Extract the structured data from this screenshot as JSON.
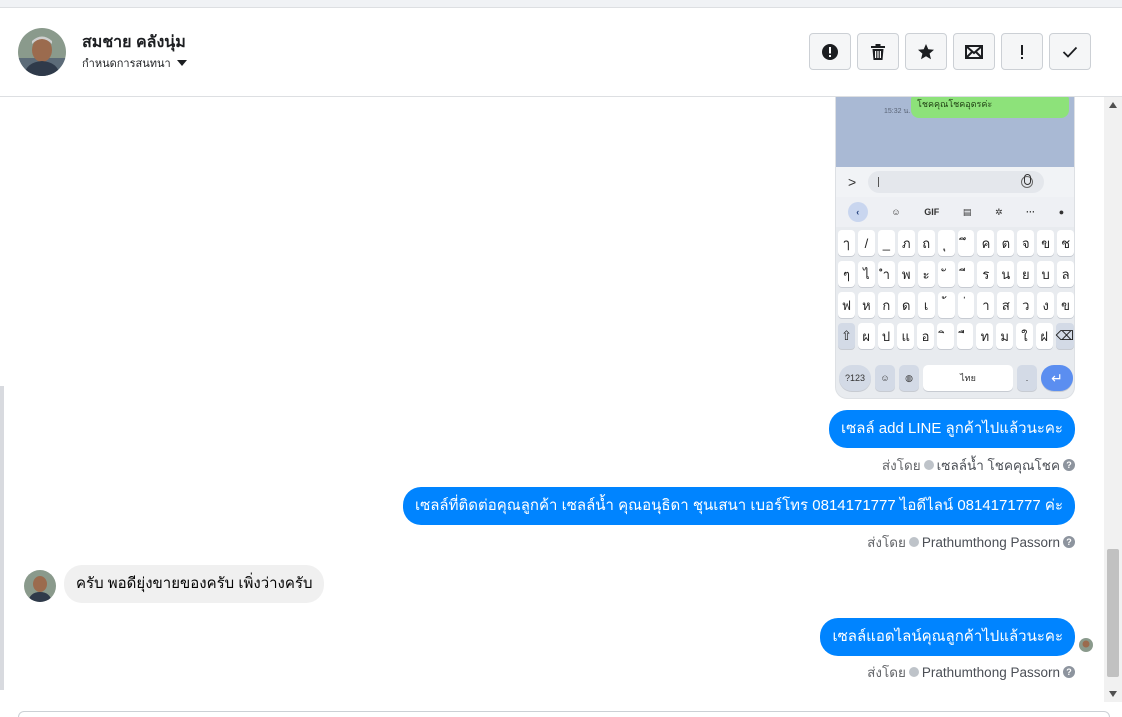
{
  "header": {
    "contact_name": "สมชาย คลังนุ่ม",
    "subtitle": "กำหนดการสนทนา"
  },
  "actions": [
    {
      "icon": "alert-circle-icon"
    },
    {
      "icon": "trash-icon"
    },
    {
      "icon": "star-icon"
    },
    {
      "icon": "mail-icon"
    },
    {
      "icon": "exclamation-icon"
    },
    {
      "icon": "check-icon"
    }
  ],
  "phone_screenshot": {
    "bubble_text": "โชคคุณโชคอุดรค่ะ",
    "time": "15:32 น.",
    "tools": [
      "GIF"
    ],
    "key_rows": [
      [
        "ๅ",
        "/",
        "_",
        "ภ",
        "ถ",
        "ุ",
        "ึ",
        "ค",
        "ต",
        "จ",
        "ข",
        "ช"
      ],
      [
        "ๆ",
        "ไ",
        "ำ",
        "พ",
        "ะ",
        "ั",
        "ี",
        "ร",
        "น",
        "ย",
        "บ",
        "ล"
      ],
      [
        "ฟ",
        "ห",
        "ก",
        "ด",
        "เ",
        "้",
        "่",
        "า",
        "ส",
        "ว",
        "ง",
        "ข"
      ],
      [
        "⇧",
        "ผ",
        "ป",
        "แ",
        "อ",
        "ิ",
        "ื",
        "ท",
        "ม",
        "ใ",
        "ฝ",
        "⌫"
      ]
    ],
    "key_123": "?123",
    "key_space": "ไทย",
    "key_period": "."
  },
  "messages": [
    {
      "text": "เซลล์ add LINE ลูกค้าไปแล้วนะคะ",
      "sent_by_label": "ส่งโดย",
      "sender": "เซลล์น้ำ โชคคุณโชค"
    },
    {
      "text": "เซลล์ที่ติดต่อคุณลูกค้า เซลล์น้ำ คุณอนุธิดา ชุนเสนา เบอร์โทร 0814171777 ไอดีไลน์ 0814171777 ค่ะ",
      "sent_by_label": "ส่งโดย",
      "sender": "Prathumthong Passorn"
    },
    {
      "text": "ครับ พอดียุ่งขายของครับ เพิ่งว่างครับ"
    },
    {
      "text": "เซลล์แอดไลน์คุณลูกค้าไปแล้วนะคะ",
      "sent_by_label": "ส่งโดย",
      "sender": "Prathumthong Passorn"
    }
  ],
  "help_glyph": "?",
  "colors": {
    "outgoing_bubble": "#0084ff",
    "incoming_bubble": "#f0f0f0",
    "muted_text": "#65676b"
  }
}
